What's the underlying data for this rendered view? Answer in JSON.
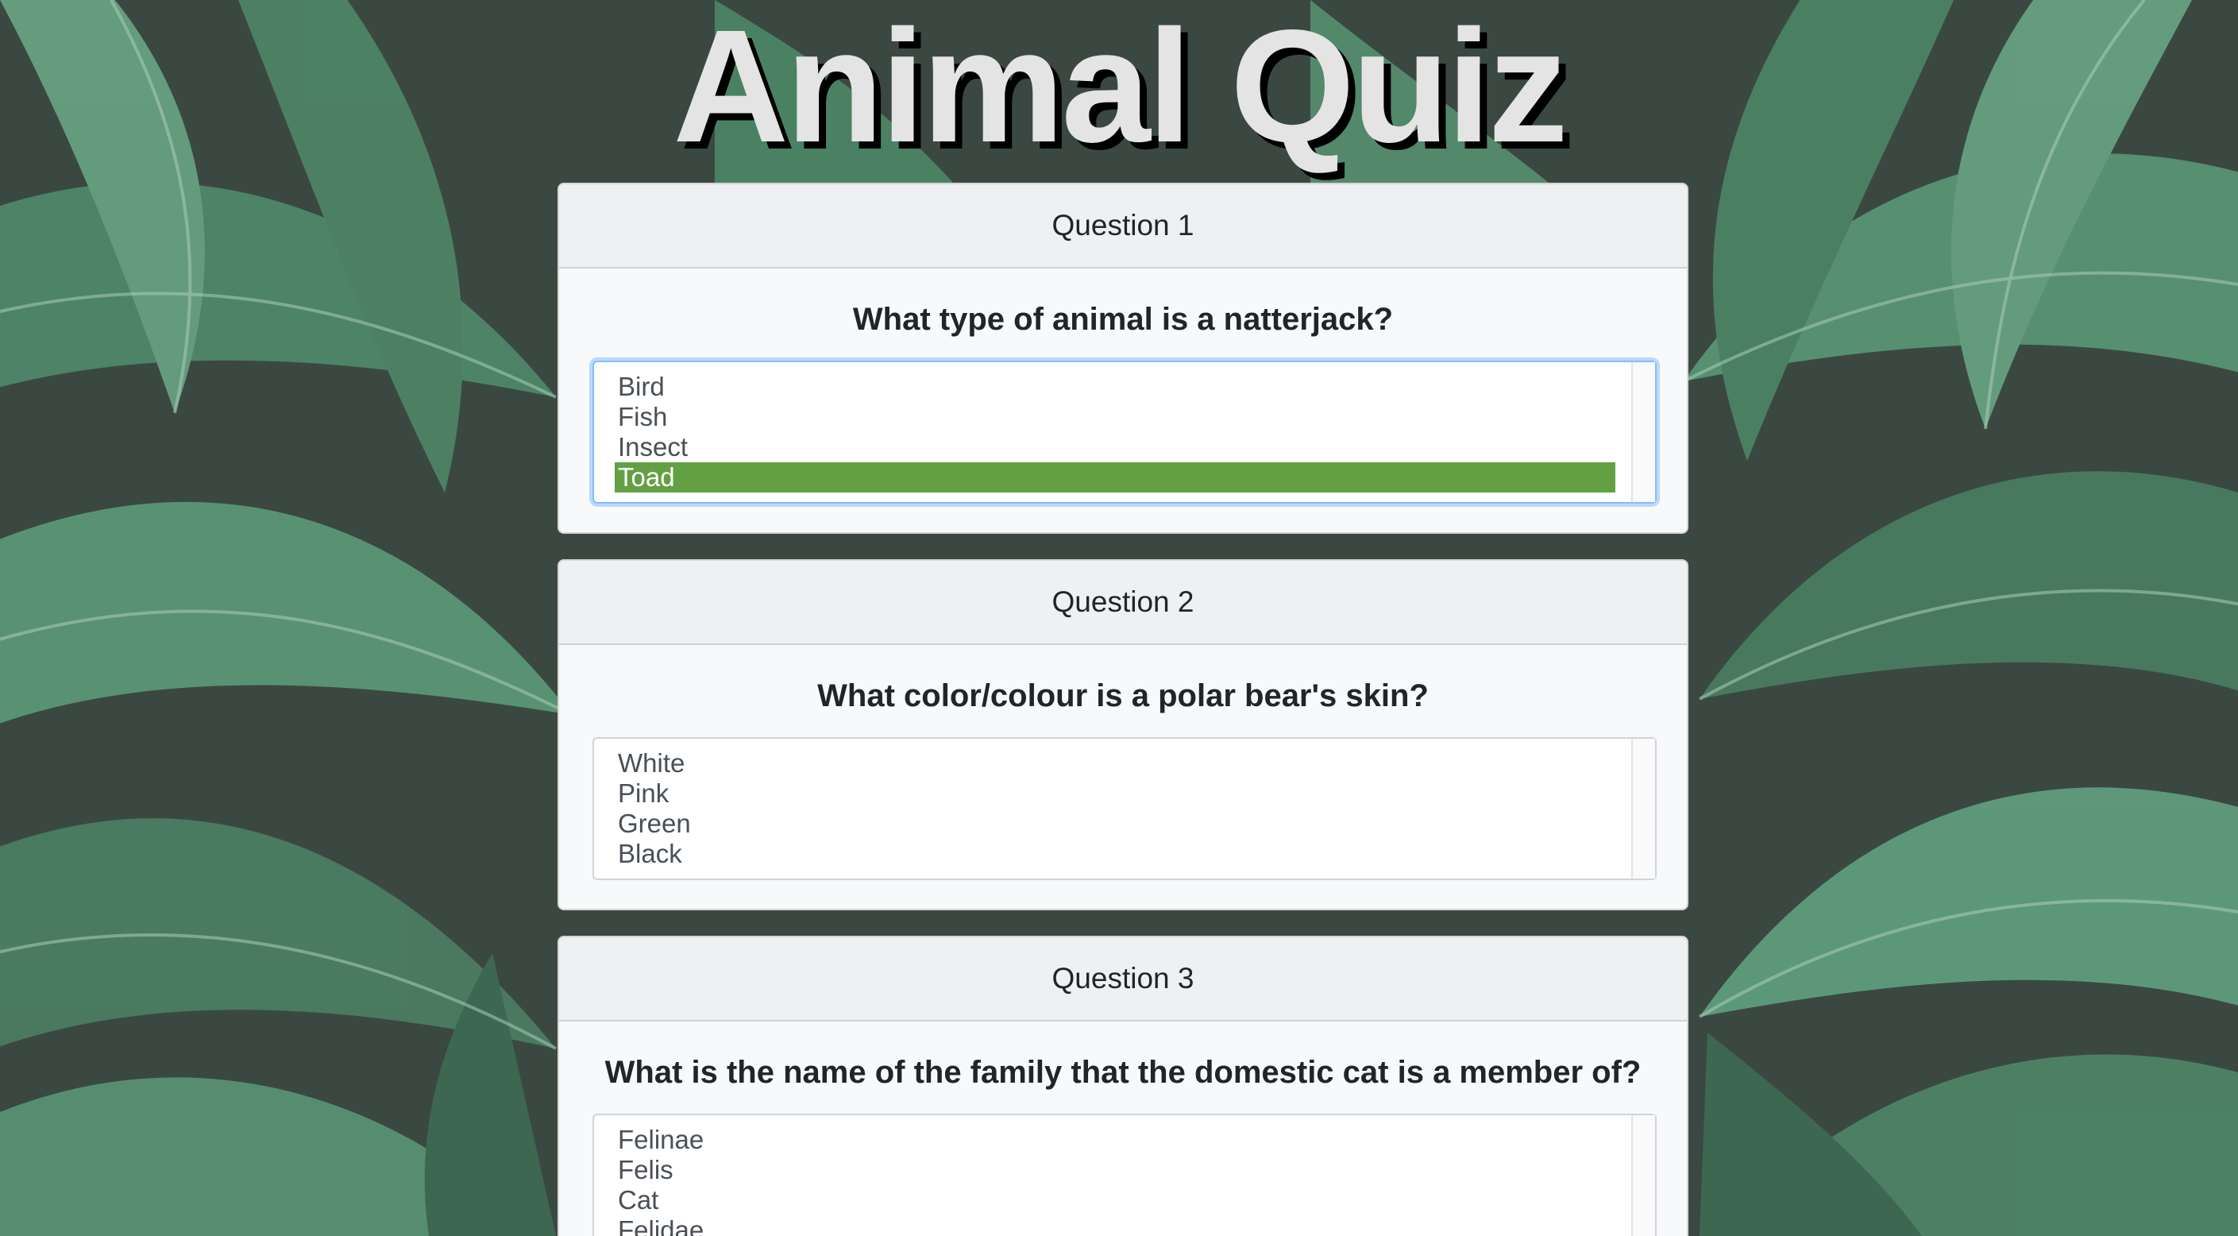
{
  "page": {
    "title": "Animal Quiz"
  },
  "questions": [
    {
      "header": "Question 1",
      "text": "What type of animal is a natterjack?",
      "options": [
        "Bird",
        "Fish",
        "Insect",
        "Toad"
      ],
      "selected": "Toad"
    },
    {
      "header": "Question 2",
      "text": "What color/colour is a polar bear's skin?",
      "options": [
        "White",
        "Pink",
        "Green",
        "Black"
      ],
      "selected": null
    },
    {
      "header": "Question 3",
      "text": "What is the name of the family that the domestic cat is a member of?",
      "options": [
        "Felinae",
        "Felis",
        "Cat",
        "Felidae"
      ],
      "selected": null
    }
  ],
  "colors": {
    "selected_option": "#63a043",
    "focus_ring": "#80bdff",
    "title_text": "#e4e4e4",
    "background_leaf": "#4a8a68"
  },
  "icons": {
    "background": "tropical-leaves-background"
  }
}
